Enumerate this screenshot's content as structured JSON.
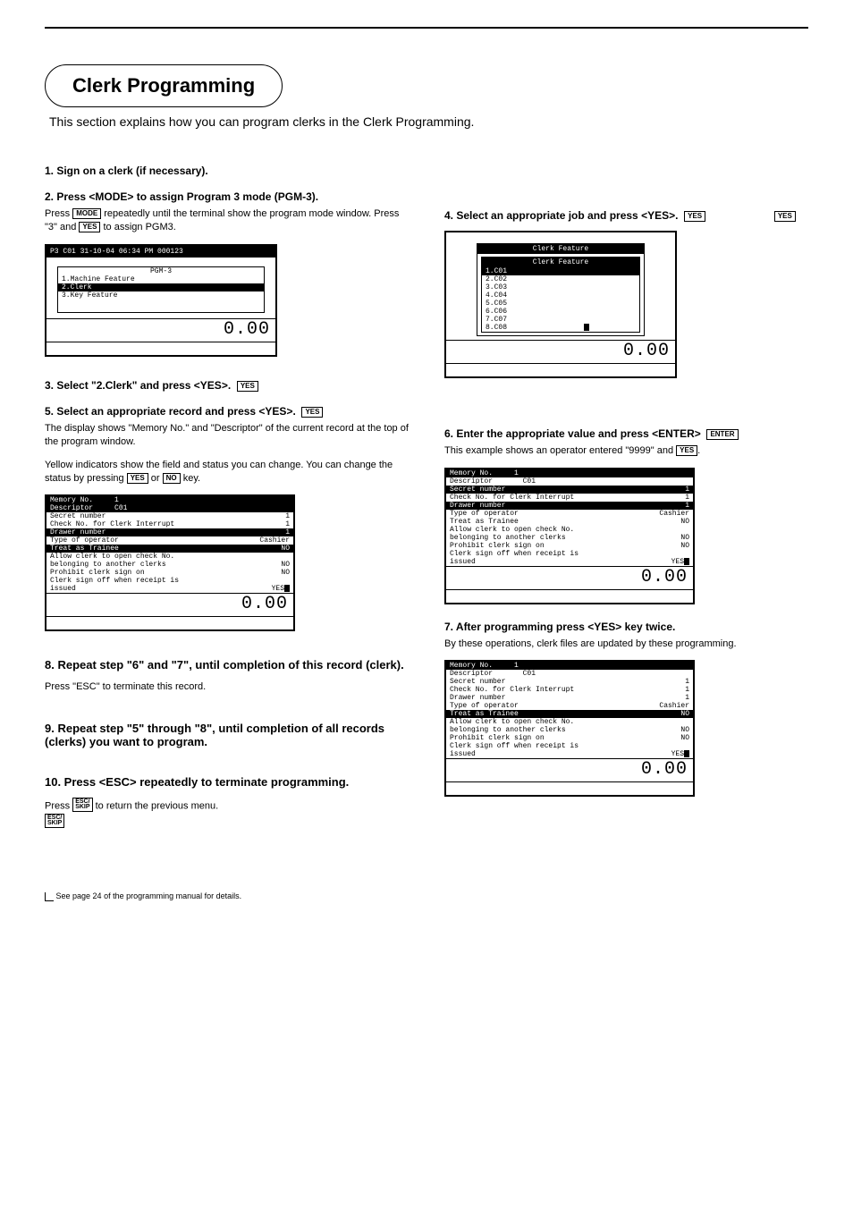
{
  "page_title": "Clerk Programming",
  "subtitle": "This section explains how you can program clerks in the Clerk Programming.",
  "steps": {
    "s1_hdr": "1. Sign on a clerk (if necessary).",
    "s2_hdr": "2. Press <MODE> to assign Program 3 mode (PGM-3).",
    "s2_body_a": "Press ",
    "s2_body_b": " repeatedly until the terminal show the program mode window. Press \"3\" and ",
    "s2_body_c": " to assign PGM3.",
    "s3_hdr": "3. Select \"2.Clerk\" and press <YES>.",
    "s4_hdr": "4. Select an appropriate job and press <YES>.",
    "s5_hdr": "5. Select an appropriate record and press <YES>.",
    "s5_body_a": "The display shows \"Memory No.\" and \"Descriptor\" of the current record at the top of the program window.",
    "s5_body_b": "Yellow indicators show the field and status you can change. You can change the status by pressing ",
    "s5_body_c": " or ",
    "s5_body_d": " key.",
    "s6_hdr": "6. Enter the appropriate value and press <ENTER>",
    "s6_body": "This example shows an operator entered \"9999\" and ",
    "s7_hdr": "7. After programming press <YES> key twice.",
    "s7_body": "By these operations, clerk files are updated by these programming.",
    "s8_hdr": "8. Repeat step \"6\" and \"7\", until completion of this record (clerk).",
    "s8_body": "Press \"ESC\" to terminate this record.",
    "s9_hdr": "9. Repeat step \"5\" through \"8\", until completion of all records (clerks) you want to program.",
    "s10_hdr": "10. Press <ESC> repeatedly to terminate programming.",
    "s10_body_a": "Press ",
    "s10_body_b": " to return the previous menu."
  },
  "lcd1": {
    "header": "P3 C01       31-10-04 06:34 PM 000123",
    "box_title": "PGM-3",
    "line1": "1.Machine Feature",
    "line2": "2.Clerk",
    "line3": "3.Key Feature",
    "total": "0.00"
  },
  "lcd2": {
    "title_outer": "Clerk Feature",
    "title_inner": "Clerk Feature",
    "c1": "1.C01",
    "c2": "2.C02",
    "c3": "3.C03",
    "c4": "4.C04",
    "c5": "5.C05",
    "c6": "6.C06",
    "c7": "7.C07",
    "c8": "8.C08",
    "total": "0.00"
  },
  "grid": {
    "mem_no_lbl": "Memory No.",
    "mem_no_val": "1",
    "desc_lbl": "Descriptor",
    "desc_val": "C01",
    "sec_lbl": "Secret number",
    "sec_val": "1",
    "chk_lbl": "Check No. for Clerk Interrupt",
    "chk_val": "1",
    "drawer_lbl": "Drawer number",
    "drawer_val": "1",
    "type_lbl": "Type of operator",
    "type_val": "Cashier",
    "trainee_lbl": "Treat as Trainee",
    "trainee_val": "NO",
    "allow_lbl": "Allow clerk to open check No.",
    "belong_lbl": "belonging to another clerks",
    "belong_val": "NO",
    "prohibit_lbl": "Prohibit clerk sign on",
    "prohibit_val": "NO",
    "signoff_lbl": "Clerk sign off when receipt is",
    "issued_lbl": "issued",
    "issued_val": "YES",
    "total": "0.00"
  },
  "keys": {
    "mode": "MODE",
    "yes": "YES",
    "no": "NO",
    "enter": "ENTER",
    "esc1": "ESC/",
    "esc2": "SKIP"
  },
  "footnote": "See page 24 of the programming manual for details."
}
